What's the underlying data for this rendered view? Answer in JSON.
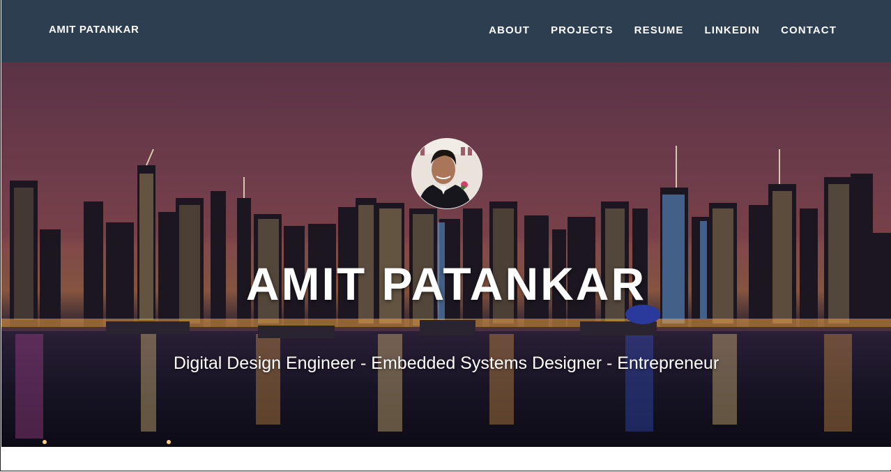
{
  "navbar": {
    "brand": "AMIT PATANKAR",
    "links": [
      {
        "label": "ABOUT"
      },
      {
        "label": "PROJECTS"
      },
      {
        "label": "RESUME"
      },
      {
        "label": "LINKEDIN"
      },
      {
        "label": "CONTACT"
      }
    ],
    "background_color": "#2c3e50"
  },
  "hero": {
    "title": "AMIT PATANKAR",
    "subtitle": "Digital Design Engineer - Embedded Systems Designer - Entrepreneur",
    "background_image": "night-city-skyline-photo",
    "avatar_icon": "profile-photo"
  }
}
